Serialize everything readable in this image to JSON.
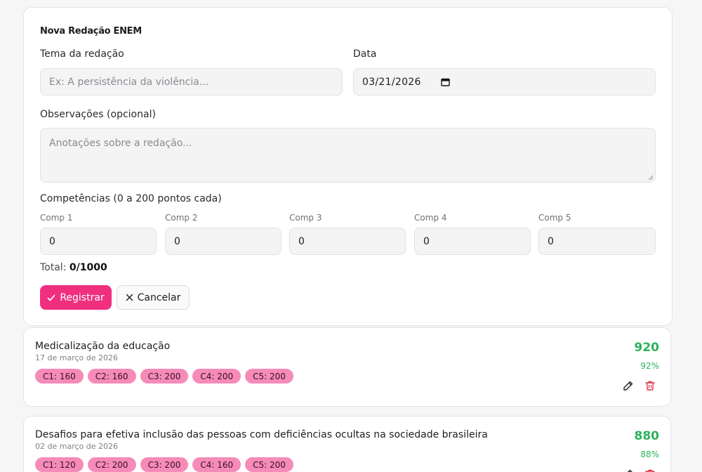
{
  "form": {
    "title": "Nova Redação ENEM",
    "theme_label": "Tema da redação",
    "theme_placeholder": "Ex: A persistência da violência...",
    "date_label": "Data",
    "date_value": "03/21/2026",
    "notes_label": "Observações (opcional)",
    "notes_placeholder": "Anotações sobre a redação...",
    "competencies_label": "Competências (0 a 200 pontos cada)",
    "competencies": [
      {
        "label": "Comp 1",
        "value": "0"
      },
      {
        "label": "Comp 2",
        "value": "0"
      },
      {
        "label": "Comp 3",
        "value": "0"
      },
      {
        "label": "Comp 4",
        "value": "0"
      },
      {
        "label": "Comp 5",
        "value": "0"
      }
    ],
    "total_label": "Total:",
    "total_value": "0/1000",
    "register_label": "Registrar",
    "cancel_label": "Cancelar"
  },
  "essays": [
    {
      "title": "Medicalização da educação",
      "date": "17 de março de 2026",
      "chips": [
        "C1: 160",
        "C2: 160",
        "C3: 200",
        "C4: 200",
        "C5: 200"
      ],
      "score": "920",
      "percent": "92%"
    },
    {
      "title": "Desafios para efetiva inclusão das pessoas com deficiências ocultas na sociedade brasileira",
      "date": "02 de março de 2026",
      "chips": [
        "C1: 120",
        "C2: 200",
        "C3: 200",
        "C4: 160",
        "C5: 200"
      ],
      "score": "880",
      "percent": "88%"
    }
  ],
  "colors": {
    "accent": "#f0307f",
    "chip": "#f58bb8",
    "score": "#2bb25c",
    "delete": "#e0344a"
  },
  "icons": {
    "calendar": "calendar-icon",
    "check": "check-icon",
    "close": "close-icon",
    "edit": "pencil-icon",
    "delete": "trash-icon"
  }
}
